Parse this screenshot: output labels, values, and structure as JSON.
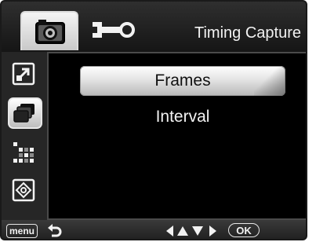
{
  "header": {
    "title": "Timing Capture",
    "tabs": [
      {
        "icon": "camera-icon",
        "selected": true
      },
      {
        "icon": "wrench-icon",
        "selected": false
      }
    ]
  },
  "sidebar": {
    "items": [
      {
        "icon": "expand-arrow-icon",
        "selected": false
      },
      {
        "icon": "stacked-frames-icon",
        "selected": true
      },
      {
        "icon": "checker-pattern-icon",
        "selected": false
      },
      {
        "icon": "focus-target-icon",
        "selected": false
      }
    ]
  },
  "menu": {
    "items": [
      {
        "label": "Frames",
        "selected": true
      },
      {
        "label": "Interval",
        "selected": false
      }
    ]
  },
  "footer": {
    "menu_key": "menu",
    "back_icon": "return-arrow-icon",
    "nav_icon": "direction-arrows-icon",
    "ok_key": "OK"
  }
}
